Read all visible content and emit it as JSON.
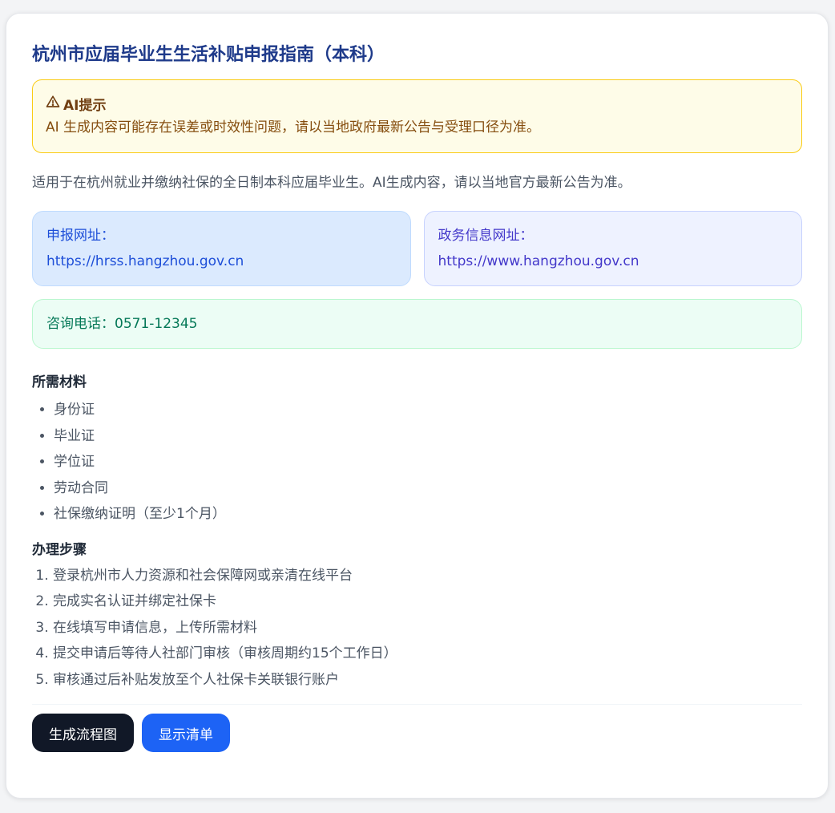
{
  "title": "杭州市应届毕业生生活补贴申报指南（本科）",
  "alert": {
    "heading": "AI提示",
    "body": "AI 生成内容可能存在误差或时效性问题，请以当地政府最新公告与受理口径为准。",
    "icon": "warning-icon",
    "border_color": "#facc15",
    "background_color": "#fefce8"
  },
  "intro": "适用于在杭州就业并缴纳社保的全日制本科应届毕业生。AI生成内容，请以当地官方最新公告为准。",
  "links": {
    "apply": {
      "label": "申报网址：",
      "url": "https://hrss.hangzhou.gov.cn"
    },
    "gov": {
      "label": "政务信息网址：",
      "url": "https://www.hangzhou.gov.cn"
    }
  },
  "phone": "咨询电话：0571-12345",
  "materials": {
    "title": "所需材料",
    "items": [
      "身份证",
      "毕业证",
      "学位证",
      "劳动合同",
      "社保缴纳证明（至少1个月）"
    ]
  },
  "steps": {
    "title": "办理步骤",
    "items": [
      "登录杭州市人力资源和社会保障网或亲清在线平台",
      "完成实名认证并绑定社保卡",
      "在线填写申请信息，上传所需材料",
      "提交申请后等待人社部门审核（审核周期约15个工作日）",
      "审核通过后补贴发放至个人社保卡关联银行账户"
    ]
  },
  "actions": {
    "flowchart_label": "生成流程图",
    "checklist_label": "显示清单"
  },
  "colors": {
    "title": "#1e3a8a",
    "primary_button": "#1d63f5",
    "dark_button": "#111827",
    "phone_text": "#047857"
  }
}
